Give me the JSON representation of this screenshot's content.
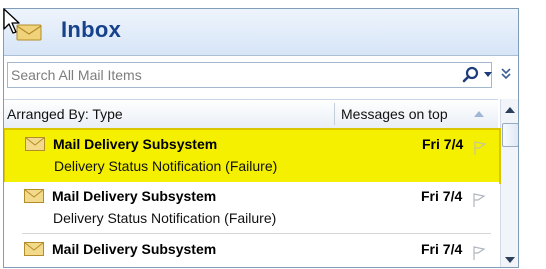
{
  "header": {
    "title": "Inbox",
    "icon": "inbox-folder-icon"
  },
  "search": {
    "placeholder": "Search All Mail Items"
  },
  "column_header": {
    "arranged_by": "Arranged By: Type",
    "sort_label": "Messages on top"
  },
  "messages": [
    {
      "sender": "Mail Delivery Subsystem",
      "subject": "Delivery Status Notification (Failure)",
      "date": "Fri 7/4",
      "selected": true
    },
    {
      "sender": "Mail Delivery Subsystem",
      "subject": "Delivery Status Notification (Failure)",
      "date": "Fri 7/4",
      "selected": false
    },
    {
      "sender": "Mail Delivery Subsystem",
      "subject": "",
      "date": "Fri 7/4",
      "selected": false
    }
  ],
  "colors": {
    "header_title": "#15428b",
    "selection": "#f4f000",
    "selection_border": "#d9c500",
    "envelope": "#e8c35a"
  }
}
